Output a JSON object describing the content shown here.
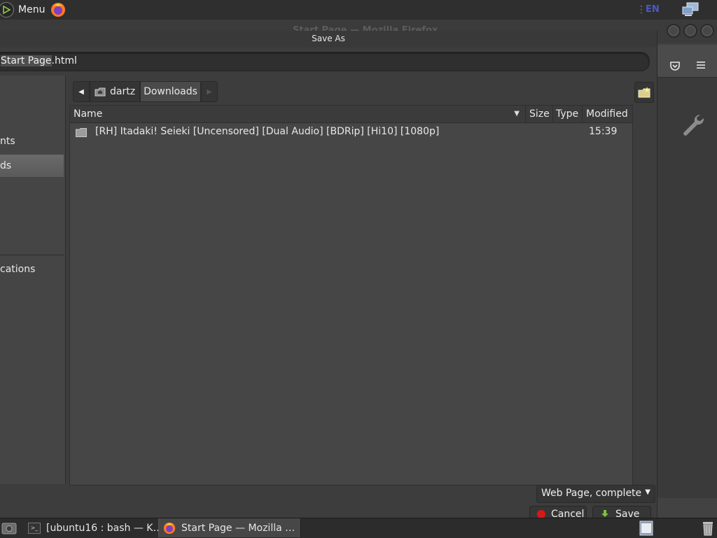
{
  "top_panel": {
    "menu_label": "Menu",
    "lang": "EN",
    "icons": [
      "mint-menu-icon",
      "firefox-launcher-icon",
      "tray-separator-icon",
      "network-icon"
    ]
  },
  "firefox": {
    "window_title": "Start Page — Mozilla Firefox",
    "icons": [
      "pocket-icon",
      "hamburger-menu-icon",
      "wrench-icon"
    ]
  },
  "dialog": {
    "title": "Save As",
    "filename_selected": "Start Page",
    "filename_ext": ".html",
    "places": [
      {
        "label": "nts",
        "active": false
      },
      {
        "label": "ds",
        "active": true
      },
      {
        "label": "cations",
        "active": false
      }
    ],
    "path": {
      "back_icon": "left-arrow-icon",
      "home": "dartz",
      "current": "Downloads",
      "forward_icon": "right-arrow-icon"
    },
    "columns": {
      "name": "Name",
      "size": "Size",
      "type": "Type",
      "modified": "Modified"
    },
    "files": [
      {
        "name": "[RH] Itadaki! Seieki [Uncensored] [Dual Audio] [BDRip] [Hi10] [1080p]",
        "size": "",
        "type": "",
        "modified": "15:39",
        "icon": "folder-icon"
      }
    ],
    "filter": "Web Page, complete",
    "cancel_label": "Cancel",
    "save_label": "Save"
  },
  "taskbar": {
    "tasks": [
      {
        "label": "[ubuntu16 : bash — K…",
        "active": false
      },
      {
        "label": "Start Page — Mozilla …",
        "active": true
      }
    ]
  },
  "colors": {
    "panel_bg": "#2f2f2f",
    "dialog_bg": "#3d3d3d",
    "list_bg": "#464646",
    "accent_lang": "#4b58c9",
    "cancel_red": "#d81818",
    "save_green": "#7ec13b"
  }
}
